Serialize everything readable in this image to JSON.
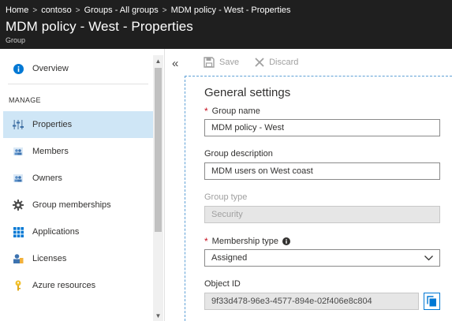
{
  "breadcrumb": {
    "items": [
      "Home",
      "contoso",
      "Groups - All groups",
      "MDM policy - West - Properties"
    ],
    "separator": ">"
  },
  "header": {
    "title": "MDM policy - West - Properties",
    "subtitle": "Group"
  },
  "nav": {
    "overview": "Overview",
    "section_manage": "MANAGE",
    "items": [
      {
        "label": "Properties",
        "icon": "properties-icon",
        "selected": true
      },
      {
        "label": "Members",
        "icon": "members-icon"
      },
      {
        "label": "Owners",
        "icon": "owners-icon"
      },
      {
        "label": "Group memberships",
        "icon": "gear-icon"
      },
      {
        "label": "Applications",
        "icon": "applications-grid-icon"
      },
      {
        "label": "Licenses",
        "icon": "licenses-icon"
      },
      {
        "label": "Azure resources",
        "icon": "key-icon"
      }
    ],
    "collapse_label": "«"
  },
  "toolbar": {
    "save_label": "Save",
    "discard_label": "Discard"
  },
  "form": {
    "section_title": "General settings",
    "group_name_label": "Group name",
    "group_name_value": "MDM policy - West",
    "group_description_label": "Group description",
    "group_description_value": "MDM users on West coast",
    "group_type_label": "Group type",
    "group_type_value": "Security",
    "membership_type_label": "Membership type",
    "membership_type_value": "Assigned",
    "object_id_label": "Object ID",
    "object_id_value": "9f33d478-96e3-4577-894e-02f406e8c804"
  },
  "colors": {
    "header_bg": "#1f1f1f",
    "selected_bg": "#cfe6f6",
    "accent": "#0078d4",
    "required": "#c50f1f"
  }
}
